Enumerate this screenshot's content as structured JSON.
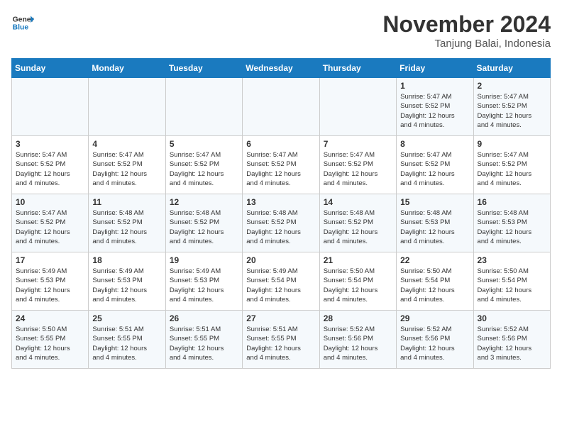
{
  "header": {
    "logo_line1": "General",
    "logo_line2": "Blue",
    "month_year": "November 2024",
    "location": "Tanjung Balai, Indonesia"
  },
  "weekdays": [
    "Sunday",
    "Monday",
    "Tuesday",
    "Wednesday",
    "Thursday",
    "Friday",
    "Saturday"
  ],
  "weeks": [
    [
      {
        "day": "",
        "info": ""
      },
      {
        "day": "",
        "info": ""
      },
      {
        "day": "",
        "info": ""
      },
      {
        "day": "",
        "info": ""
      },
      {
        "day": "",
        "info": ""
      },
      {
        "day": "1",
        "info": "Sunrise: 5:47 AM\nSunset: 5:52 PM\nDaylight: 12 hours\nand 4 minutes."
      },
      {
        "day": "2",
        "info": "Sunrise: 5:47 AM\nSunset: 5:52 PM\nDaylight: 12 hours\nand 4 minutes."
      }
    ],
    [
      {
        "day": "3",
        "info": "Sunrise: 5:47 AM\nSunset: 5:52 PM\nDaylight: 12 hours\nand 4 minutes."
      },
      {
        "day": "4",
        "info": "Sunrise: 5:47 AM\nSunset: 5:52 PM\nDaylight: 12 hours\nand 4 minutes."
      },
      {
        "day": "5",
        "info": "Sunrise: 5:47 AM\nSunset: 5:52 PM\nDaylight: 12 hours\nand 4 minutes."
      },
      {
        "day": "6",
        "info": "Sunrise: 5:47 AM\nSunset: 5:52 PM\nDaylight: 12 hours\nand 4 minutes."
      },
      {
        "day": "7",
        "info": "Sunrise: 5:47 AM\nSunset: 5:52 PM\nDaylight: 12 hours\nand 4 minutes."
      },
      {
        "day": "8",
        "info": "Sunrise: 5:47 AM\nSunset: 5:52 PM\nDaylight: 12 hours\nand 4 minutes."
      },
      {
        "day": "9",
        "info": "Sunrise: 5:47 AM\nSunset: 5:52 PM\nDaylight: 12 hours\nand 4 minutes."
      }
    ],
    [
      {
        "day": "10",
        "info": "Sunrise: 5:47 AM\nSunset: 5:52 PM\nDaylight: 12 hours\nand 4 minutes."
      },
      {
        "day": "11",
        "info": "Sunrise: 5:48 AM\nSunset: 5:52 PM\nDaylight: 12 hours\nand 4 minutes."
      },
      {
        "day": "12",
        "info": "Sunrise: 5:48 AM\nSunset: 5:52 PM\nDaylight: 12 hours\nand 4 minutes."
      },
      {
        "day": "13",
        "info": "Sunrise: 5:48 AM\nSunset: 5:52 PM\nDaylight: 12 hours\nand 4 minutes."
      },
      {
        "day": "14",
        "info": "Sunrise: 5:48 AM\nSunset: 5:52 PM\nDaylight: 12 hours\nand 4 minutes."
      },
      {
        "day": "15",
        "info": "Sunrise: 5:48 AM\nSunset: 5:53 PM\nDaylight: 12 hours\nand 4 minutes."
      },
      {
        "day": "16",
        "info": "Sunrise: 5:48 AM\nSunset: 5:53 PM\nDaylight: 12 hours\nand 4 minutes."
      }
    ],
    [
      {
        "day": "17",
        "info": "Sunrise: 5:49 AM\nSunset: 5:53 PM\nDaylight: 12 hours\nand 4 minutes."
      },
      {
        "day": "18",
        "info": "Sunrise: 5:49 AM\nSunset: 5:53 PM\nDaylight: 12 hours\nand 4 minutes."
      },
      {
        "day": "19",
        "info": "Sunrise: 5:49 AM\nSunset: 5:53 PM\nDaylight: 12 hours\nand 4 minutes."
      },
      {
        "day": "20",
        "info": "Sunrise: 5:49 AM\nSunset: 5:54 PM\nDaylight: 12 hours\nand 4 minutes."
      },
      {
        "day": "21",
        "info": "Sunrise: 5:50 AM\nSunset: 5:54 PM\nDaylight: 12 hours\nand 4 minutes."
      },
      {
        "day": "22",
        "info": "Sunrise: 5:50 AM\nSunset: 5:54 PM\nDaylight: 12 hours\nand 4 minutes."
      },
      {
        "day": "23",
        "info": "Sunrise: 5:50 AM\nSunset: 5:54 PM\nDaylight: 12 hours\nand 4 minutes."
      }
    ],
    [
      {
        "day": "24",
        "info": "Sunrise: 5:50 AM\nSunset: 5:55 PM\nDaylight: 12 hours\nand 4 minutes."
      },
      {
        "day": "25",
        "info": "Sunrise: 5:51 AM\nSunset: 5:55 PM\nDaylight: 12 hours\nand 4 minutes."
      },
      {
        "day": "26",
        "info": "Sunrise: 5:51 AM\nSunset: 5:55 PM\nDaylight: 12 hours\nand 4 minutes."
      },
      {
        "day": "27",
        "info": "Sunrise: 5:51 AM\nSunset: 5:55 PM\nDaylight: 12 hours\nand 4 minutes."
      },
      {
        "day": "28",
        "info": "Sunrise: 5:52 AM\nSunset: 5:56 PM\nDaylight: 12 hours\nand 4 minutes."
      },
      {
        "day": "29",
        "info": "Sunrise: 5:52 AM\nSunset: 5:56 PM\nDaylight: 12 hours\nand 4 minutes."
      },
      {
        "day": "30",
        "info": "Sunrise: 5:52 AM\nSunset: 5:56 PM\nDaylight: 12 hours\nand 3 minutes."
      }
    ]
  ]
}
